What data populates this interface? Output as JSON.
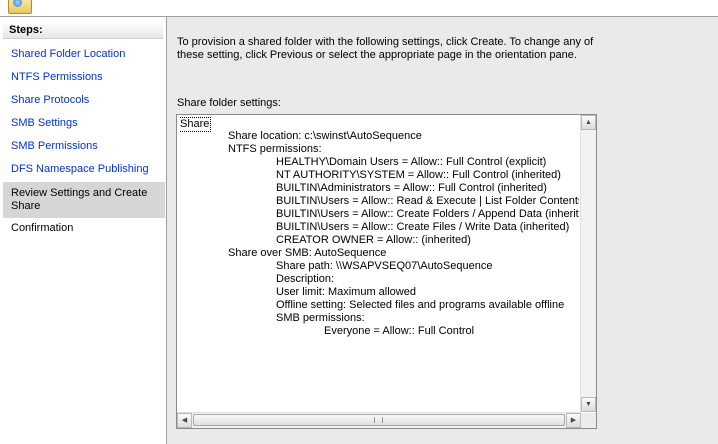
{
  "nav": {
    "header": "Steps:",
    "items": [
      {
        "label": "Shared Folder Location"
      },
      {
        "label": "NTFS Permissions"
      },
      {
        "label": "Share Protocols"
      },
      {
        "label": "SMB Settings"
      },
      {
        "label": "SMB Permissions"
      },
      {
        "label": "DFS Namespace Publishing"
      },
      {
        "label": "Review Settings and Create Share"
      },
      {
        "label": "Confirmation"
      }
    ],
    "selected_index": 6
  },
  "main": {
    "intro": "To provision a shared folder with the following settings, click Create. To change any of these setting, click Previous or select the appropriate page in the orientation pane.",
    "settings_label": "Share folder settings:",
    "settings_lines": [
      "Share",
      "Share location: c:\\swinst\\AutoSequence",
      "NTFS permissions:",
      "HEALTHY\\Domain Users = Allow:: Full Control (explicit)",
      "NT AUTHORITY\\SYSTEM = Allow:: Full Control (inherited)",
      "BUILTIN\\Administrators = Allow:: Full Control (inherited)",
      "BUILTIN\\Users = Allow:: Read & Execute | List Folder Contents | Read (inherited)",
      "BUILTIN\\Users = Allow:: Create Folders / Append Data (inherited)",
      "BUILTIN\\Users = Allow:: Create Files / Write Data (inherited)",
      "CREATOR OWNER = Allow::  (inherited)",
      "Share over SMB: AutoSequence",
      "Share path: \\\\WSAPVSEQ07\\AutoSequence",
      "Description:",
      "User limit: Maximum allowed",
      "Offline setting: Selected files and programs available offline",
      "SMB permissions:",
      "Everyone = Allow:: Full Control"
    ]
  },
  "icons": {
    "banner": "share-folder-wizard-icon",
    "scroll_up": "scroll-up-arrow-icon",
    "scroll_down": "scroll-down-arrow-icon",
    "scroll_left": "scroll-left-arrow-icon",
    "scroll_right": "scroll-right-arrow-icon"
  }
}
